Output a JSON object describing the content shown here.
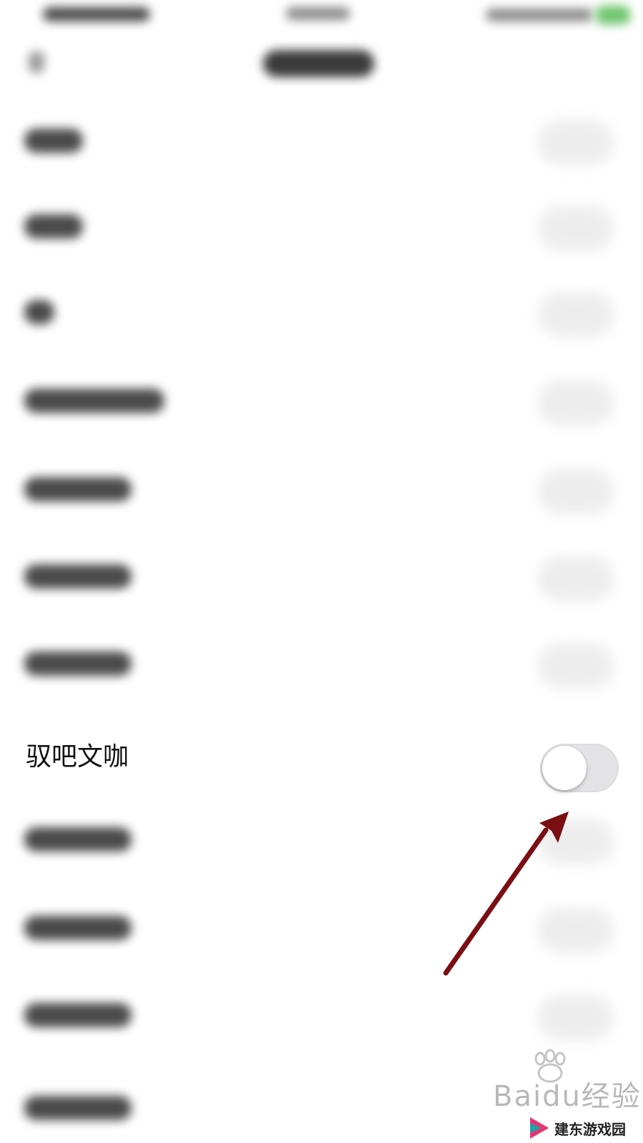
{
  "settings": {
    "featured_row": {
      "label": "驭吧文咖",
      "toggle_on": false
    }
  },
  "watermark": {
    "baidu_text": "Baidu经验",
    "site_name": "建东游戏园"
  },
  "colors": {
    "arrow": "#7a0e12",
    "toggle_track_off": "#e3e3e6",
    "toggle_knob": "#ffffff",
    "status_accent": "#6cc56c"
  }
}
